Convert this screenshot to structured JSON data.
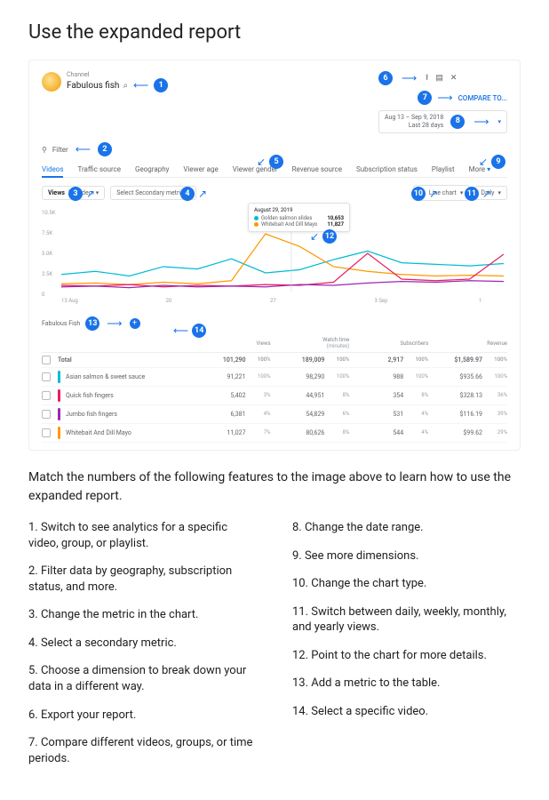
{
  "page_title": "Use the expanded report",
  "channel": {
    "label": "Channel",
    "name": "Fabulous fish"
  },
  "top_icons": {
    "export": "⭱",
    "feedback": "▤",
    "close": "✕"
  },
  "compare_label": "COMPARE TO...",
  "date_range": {
    "line1": "Aug 13 – Sep 9, 2018",
    "line2": "Last 28 days"
  },
  "filter_label": "Filter",
  "tabs": [
    "Videos",
    "Traffic source",
    "Geography",
    "Viewer age",
    "Viewer gender",
    "Revenue source",
    "Subscription status",
    "Playlist"
  ],
  "more_label": "More",
  "primary_metric": {
    "prefix": "Views",
    "suffix": "by Video"
  },
  "secondary_metric": "Select Secondary metric",
  "chart_type": "Line chart",
  "granularity": "Daily",
  "tooltip": {
    "date": "August 29, 2019",
    "series": [
      {
        "color": "#00bcd4",
        "label": "Golden salmon slides",
        "value": "10,653"
      },
      {
        "color": "#ff9800",
        "label": "Whitebait And Dill Mayo",
        "value": "11,827"
      }
    ]
  },
  "yaxis": [
    "10.5K",
    "7.5K",
    "5.0K",
    "2.5K",
    "0"
  ],
  "xaxis": [
    "13 Aug",
    "20",
    "27",
    "3 Sep",
    "1"
  ],
  "table": {
    "group_title": "Fabulous Fish",
    "headers": [
      "",
      "",
      "Views",
      "Watch time (minutes)",
      "Subscribers",
      "Revenue"
    ],
    "rows": [
      {
        "mark": "",
        "name": "Total",
        "views": "101,290",
        "views_pct": "100%",
        "watch": "189,009",
        "watch_pct": "100%",
        "subs": "2,917",
        "subs_pct": "100%",
        "rev": "$1,589.97",
        "rev_pct": "100%",
        "bold": true
      },
      {
        "mark": "#00bcd4",
        "name": "Asian salmon & sweet sauce",
        "views": "91,221",
        "views_pct": "100%",
        "watch": "98,290",
        "watch_pct": "100%",
        "subs": "988",
        "subs_pct": "100%",
        "rev": "$935.66",
        "rev_pct": "100%"
      },
      {
        "mark": "#e91e63",
        "name": "Quick fish fingers",
        "views": "5,402",
        "views_pct": "3%",
        "watch": "44,951",
        "watch_pct": "8%",
        "subs": "354",
        "subs_pct": "8%",
        "rev": "$328.13",
        "rev_pct": "36%"
      },
      {
        "mark": "#9c27b0",
        "name": "Jumbo fish fingers",
        "views": "6,381",
        "views_pct": "4%",
        "watch": "54,829",
        "watch_pct": "6%",
        "subs": "531",
        "subs_pct": "4%",
        "rev": "$116.19",
        "rev_pct": "39%"
      },
      {
        "mark": "#ff9800",
        "name": "Whitebait And Dill Mayo",
        "views": "11,027",
        "views_pct": "7%",
        "watch": "80,626",
        "watch_pct": "8%",
        "subs": "544",
        "subs_pct": "4%",
        "rev": "$99.62",
        "rev_pct": "29%"
      }
    ]
  },
  "caption": "Match the numbers of the following features to the image above to learn how to use the expanded report.",
  "legend_left": [
    "1. Switch to see analytics for a specific video, group, or playlist.",
    "2. Filter data by geography, subscription status, and more.",
    "3. Change the metric in the chart.",
    "4. Select a secondary metric.",
    "5. Choose a dimension to break down your data in a different way.",
    "6. Export your report.",
    "7. Compare different videos, groups, or time periods."
  ],
  "legend_right": [
    "8. Change the date range.",
    "9. See more dimensions.",
    "10. Change the chart type.",
    "11. Switch between daily, weekly, monthly, and yearly views.",
    "12. Point to the chart for more details.",
    "13. Add a metric to the table.",
    "14. Select a specific video."
  ],
  "chart_data": {
    "type": "line",
    "xlabel": "",
    "ylabel": "",
    "ylim": [
      0,
      10500
    ],
    "x": [
      "13 Aug",
      "20",
      "27",
      "3 Sep",
      "1"
    ],
    "series": [
      {
        "name": "Asian salmon & sweet sauce",
        "color": "#00bcd4",
        "values": [
          2200,
          2600,
          2000,
          3200,
          2900,
          4200,
          2400,
          2800,
          4100,
          5200,
          3700,
          3500,
          3300,
          3600
        ]
      },
      {
        "name": "Whitebait And Dill Mayo",
        "color": "#ff9800",
        "values": [
          1000,
          1100,
          900,
          1200,
          1000,
          1400,
          7400,
          5800,
          3200,
          2600,
          2200,
          2000,
          2100,
          2000
        ]
      },
      {
        "name": "Quick fish fingers",
        "color": "#e91e63",
        "values": [
          800,
          700,
          900,
          600,
          800,
          700,
          900,
          800,
          1200,
          4900,
          1600,
          1400,
          1600,
          4800
        ]
      },
      {
        "name": "Jumbo fish fingers",
        "color": "#9c27b0",
        "values": [
          600,
          700,
          500,
          800,
          600,
          700,
          600,
          900,
          800,
          1100,
          1300,
          1200,
          1400,
          1300
        ]
      }
    ]
  }
}
